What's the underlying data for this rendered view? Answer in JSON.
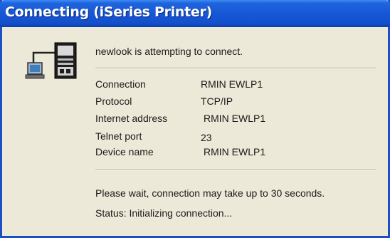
{
  "dialog": {
    "title": "Connecting (iSeries Printer)",
    "message": "newlook is attempting to connect.",
    "details": [
      {
        "label": "Connection",
        "value": "RMIN EWLP1"
      },
      {
        "label": "Protocol",
        "value": "TCP/IP"
      },
      {
        "label": "Internet address",
        "value": "RMIN EWLP1"
      },
      {
        "label": "Telnet port",
        "value": "23"
      },
      {
        "label": "Device name",
        "value": "RMIN EWLP1"
      }
    ],
    "wait_note": "Please wait, connection may take up to 30 seconds.",
    "status": "Status: Initializing connection..."
  },
  "colors": {
    "titlebar": "#1757d6",
    "frame": "#1c4fc4",
    "body": "#ece9d8"
  },
  "icons": {
    "header_icon": "computer-connecting-to-server-icon"
  }
}
